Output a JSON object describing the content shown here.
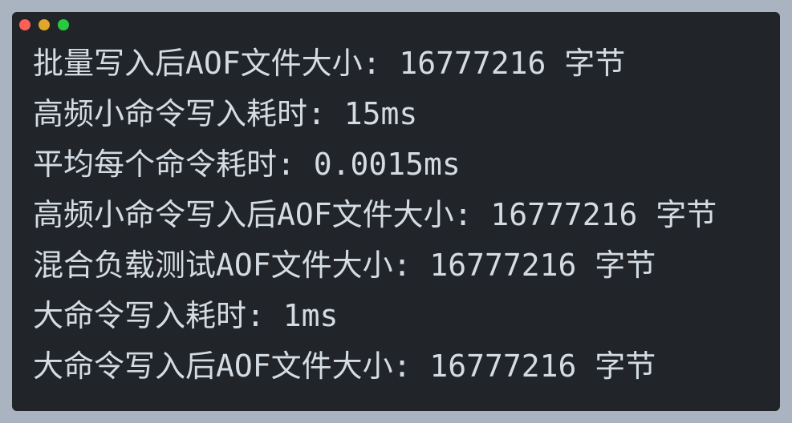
{
  "window": {
    "controls": {
      "close_color": "#ff5f56",
      "minimize_color": "#e0a72a",
      "maximize_color": "#27c93f"
    }
  },
  "terminal": {
    "background": "#212529",
    "text_color": "#d4dbe3",
    "lines": [
      "批量写入后AOF文件大小: 16777216 字节",
      "高频小命令写入耗时: 15ms",
      "平均每个命令耗时: 0.0015ms",
      "高频小命令写入后AOF文件大小: 16777216 字节",
      "混合负载测试AOF文件大小: 16777216 字节",
      "大命令写入耗时: 1ms",
      "大命令写入后AOF文件大小: 16777216 字节"
    ]
  }
}
